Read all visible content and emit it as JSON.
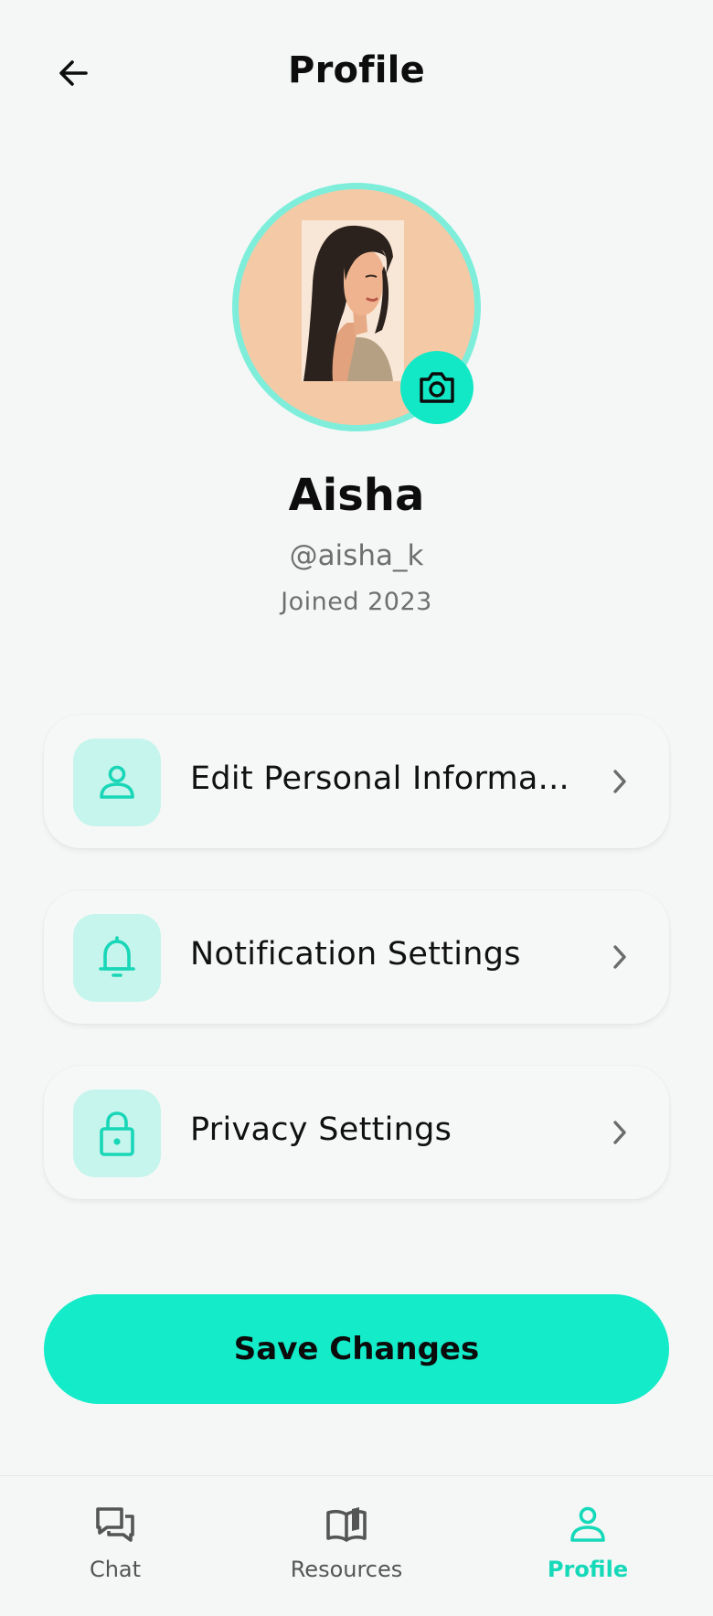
{
  "header": {
    "title": "Profile"
  },
  "profile": {
    "name": "Aisha",
    "handle": "@aisha_k",
    "joined": "Joined 2023"
  },
  "menu": [
    {
      "label": "Edit Personal Informa...",
      "icon": "person-icon"
    },
    {
      "label": "Notification Settings",
      "icon": "bell-icon"
    },
    {
      "label": "Privacy Settings",
      "icon": "lock-icon"
    }
  ],
  "save_button": {
    "label": "Save Changes"
  },
  "bottom_nav": [
    {
      "label": "Chat",
      "icon": "chat-icon",
      "active": false
    },
    {
      "label": "Resources",
      "icon": "book-icon",
      "active": false
    },
    {
      "label": "Profile",
      "icon": "person-icon",
      "active": true
    }
  ],
  "colors": {
    "accent": "#13ebc9",
    "accent_light": "#c5f5ec",
    "avatar_ring": "#7eeedb",
    "active_nav": "#16d9b9"
  }
}
